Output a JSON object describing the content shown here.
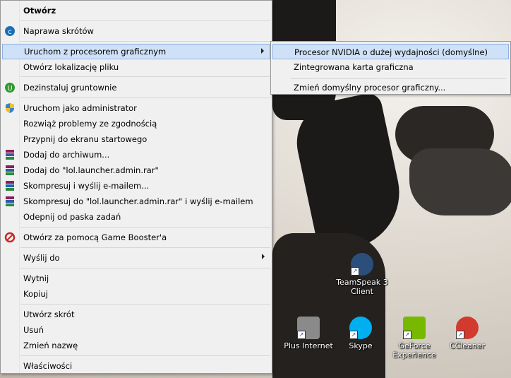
{
  "menu": {
    "items": [
      {
        "label": "Otwórz",
        "icon": "none",
        "bold": true
      },
      {
        "label": "Naprawa skrótów",
        "icon": "repair-icon"
      },
      {
        "label": "Uruchom z procesorem graficznym",
        "icon": "none",
        "submenu": true,
        "highlighted": true
      },
      {
        "label": "Otwórz lokalizację pliku",
        "icon": "none"
      },
      {
        "label": "Dezinstaluj gruntownie",
        "icon": "uninstall-icon"
      },
      {
        "label": "Uruchom jako administrator",
        "icon": "uac-shield-icon"
      },
      {
        "label": "Rozwiąż problemy ze zgodnością",
        "icon": "none"
      },
      {
        "label": "Przypnij do ekranu startowego",
        "icon": "none"
      },
      {
        "label": "Dodaj do archiwum...",
        "icon": "winrar-icon"
      },
      {
        "label": "Dodaj do \"lol.launcher.admin.rar\"",
        "icon": "winrar-icon"
      },
      {
        "label": "Skompresuj i wyślij e-mailem...",
        "icon": "winrar-icon"
      },
      {
        "label": "Skompresuj do \"lol.launcher.admin.rar\" i wyślij e-mailem",
        "icon": "winrar-icon"
      },
      {
        "label": "Odepnij od paska zadań",
        "icon": "none"
      },
      {
        "label": "Otwórz za pomocą Game Booster'a",
        "icon": "game-booster-icon"
      },
      {
        "label": "Wyślij do",
        "icon": "none",
        "submenu": true
      },
      {
        "label": "Wytnij",
        "icon": "none"
      },
      {
        "label": "Kopiuj",
        "icon": "none"
      },
      {
        "label": "Utwórz skrót",
        "icon": "none"
      },
      {
        "label": "Usuń",
        "icon": "none"
      },
      {
        "label": "Zmień nazwę",
        "icon": "none"
      },
      {
        "label": "Właściwości",
        "icon": "none"
      }
    ]
  },
  "submenu": {
    "items": [
      {
        "label": "Procesor NVIDIA o dużej wydajności (domyślne)",
        "highlighted": true
      },
      {
        "label": "Zintegrowana karta graficzna"
      },
      {
        "label": "Zmień domyślny procesor graficzny..."
      }
    ]
  },
  "desktop_icons": [
    {
      "label": "TeamSpeak 3 Client",
      "icon": "teamspeak-icon",
      "color": "#2b4f7a"
    },
    {
      "label": "Plus Internet",
      "icon": "plus-internet-icon",
      "color": "#8a8a8a"
    },
    {
      "label": "Skype",
      "icon": "skype-icon",
      "color": "#00aff0"
    },
    {
      "label": "GeForce Experience",
      "icon": "geforce-icon",
      "color": "#76b900"
    },
    {
      "label": "CCleaner",
      "icon": "ccleaner-icon",
      "color": "#d23a2e"
    }
  ],
  "colors": {
    "menu_bg": "#f0f0f0",
    "highlight": "#cfe1f6",
    "highlight_border": "#8db2e3"
  }
}
